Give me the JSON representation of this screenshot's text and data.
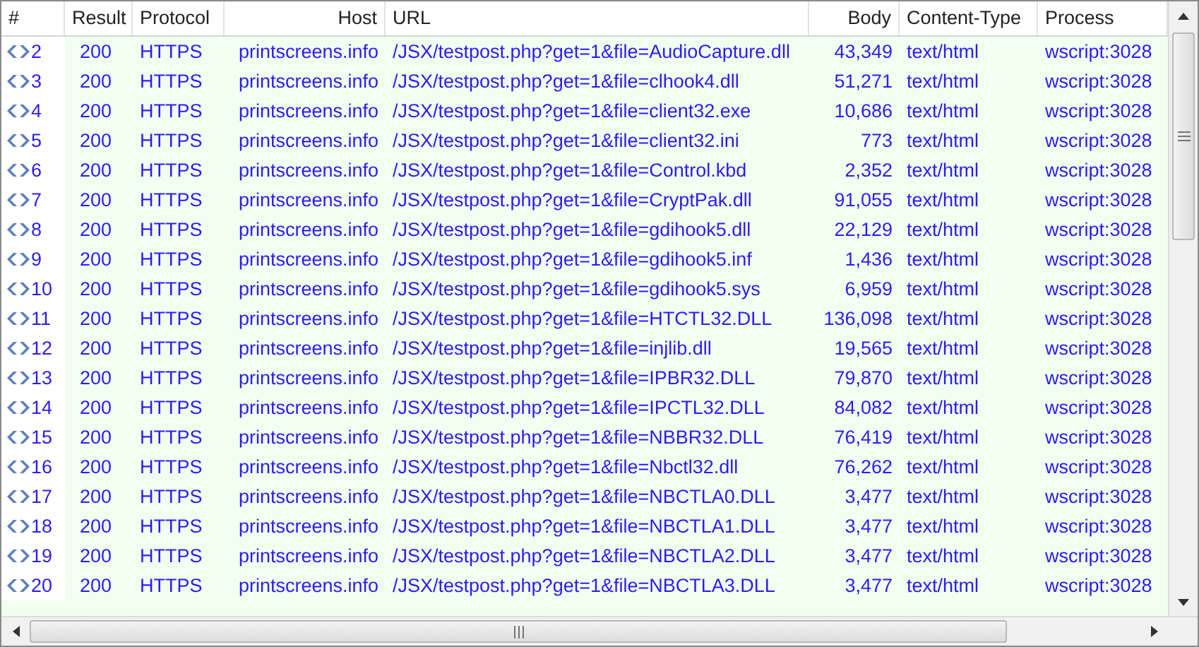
{
  "columns": [
    {
      "label": "#"
    },
    {
      "label": "Result"
    },
    {
      "label": "Protocol"
    },
    {
      "label": "Host"
    },
    {
      "label": "URL"
    },
    {
      "label": "Body"
    },
    {
      "label": "Content-Type"
    },
    {
      "label": "Process"
    }
  ],
  "rows": [
    {
      "id": "2",
      "result": "200",
      "protocol": "HTTPS",
      "host": "printscreens.info",
      "url": "/JSX/testpost.php?get=1&file=AudioCapture.dll",
      "body": "43,349",
      "type": "text/html",
      "process": "wscript:3028"
    },
    {
      "id": "3",
      "result": "200",
      "protocol": "HTTPS",
      "host": "printscreens.info",
      "url": "/JSX/testpost.php?get=1&file=clhook4.dll",
      "body": "51,271",
      "type": "text/html",
      "process": "wscript:3028"
    },
    {
      "id": "4",
      "result": "200",
      "protocol": "HTTPS",
      "host": "printscreens.info",
      "url": "/JSX/testpost.php?get=1&file=client32.exe",
      "body": "10,686",
      "type": "text/html",
      "process": "wscript:3028"
    },
    {
      "id": "5",
      "result": "200",
      "protocol": "HTTPS",
      "host": "printscreens.info",
      "url": "/JSX/testpost.php?get=1&file=client32.ini",
      "body": "773",
      "type": "text/html",
      "process": "wscript:3028"
    },
    {
      "id": "6",
      "result": "200",
      "protocol": "HTTPS",
      "host": "printscreens.info",
      "url": "/JSX/testpost.php?get=1&file=Control.kbd",
      "body": "2,352",
      "type": "text/html",
      "process": "wscript:3028"
    },
    {
      "id": "7",
      "result": "200",
      "protocol": "HTTPS",
      "host": "printscreens.info",
      "url": "/JSX/testpost.php?get=1&file=CryptPak.dll",
      "body": "91,055",
      "type": "text/html",
      "process": "wscript:3028"
    },
    {
      "id": "8",
      "result": "200",
      "protocol": "HTTPS",
      "host": "printscreens.info",
      "url": "/JSX/testpost.php?get=1&file=gdihook5.dll",
      "body": "22,129",
      "type": "text/html",
      "process": "wscript:3028"
    },
    {
      "id": "9",
      "result": "200",
      "protocol": "HTTPS",
      "host": "printscreens.info",
      "url": "/JSX/testpost.php?get=1&file=gdihook5.inf",
      "body": "1,436",
      "type": "text/html",
      "process": "wscript:3028"
    },
    {
      "id": "10",
      "result": "200",
      "protocol": "HTTPS",
      "host": "printscreens.info",
      "url": "/JSX/testpost.php?get=1&file=gdihook5.sys",
      "body": "6,959",
      "type": "text/html",
      "process": "wscript:3028"
    },
    {
      "id": "11",
      "result": "200",
      "protocol": "HTTPS",
      "host": "printscreens.info",
      "url": "/JSX/testpost.php?get=1&file=HTCTL32.DLL",
      "body": "136,098",
      "type": "text/html",
      "process": "wscript:3028"
    },
    {
      "id": "12",
      "result": "200",
      "protocol": "HTTPS",
      "host": "printscreens.info",
      "url": "/JSX/testpost.php?get=1&file=injlib.dll",
      "body": "19,565",
      "type": "text/html",
      "process": "wscript:3028"
    },
    {
      "id": "13",
      "result": "200",
      "protocol": "HTTPS",
      "host": "printscreens.info",
      "url": "/JSX/testpost.php?get=1&file=IPBR32.DLL",
      "body": "79,870",
      "type": "text/html",
      "process": "wscript:3028"
    },
    {
      "id": "14",
      "result": "200",
      "protocol": "HTTPS",
      "host": "printscreens.info",
      "url": "/JSX/testpost.php?get=1&file=IPCTL32.DLL",
      "body": "84,082",
      "type": "text/html",
      "process": "wscript:3028"
    },
    {
      "id": "15",
      "result": "200",
      "protocol": "HTTPS",
      "host": "printscreens.info",
      "url": "/JSX/testpost.php?get=1&file=NBBR32.DLL",
      "body": "76,419",
      "type": "text/html",
      "process": "wscript:3028"
    },
    {
      "id": "16",
      "result": "200",
      "protocol": "HTTPS",
      "host": "printscreens.info",
      "url": "/JSX/testpost.php?get=1&file=Nbctl32.dll",
      "body": "76,262",
      "type": "text/html",
      "process": "wscript:3028"
    },
    {
      "id": "17",
      "result": "200",
      "protocol": "HTTPS",
      "host": "printscreens.info",
      "url": "/JSX/testpost.php?get=1&file=NBCTLA0.DLL",
      "body": "3,477",
      "type": "text/html",
      "process": "wscript:3028"
    },
    {
      "id": "18",
      "result": "200",
      "protocol": "HTTPS",
      "host": "printscreens.info",
      "url": "/JSX/testpost.php?get=1&file=NBCTLA1.DLL",
      "body": "3,477",
      "type": "text/html",
      "process": "wscript:3028"
    },
    {
      "id": "19",
      "result": "200",
      "protocol": "HTTPS",
      "host": "printscreens.info",
      "url": "/JSX/testpost.php?get=1&file=NBCTLA2.DLL",
      "body": "3,477",
      "type": "text/html",
      "process": "wscript:3028"
    },
    {
      "id": "20",
      "result": "200",
      "protocol": "HTTPS",
      "host": "printscreens.info",
      "url": "/JSX/testpost.php?get=1&file=NBCTLA3.DLL",
      "body": "3,477",
      "type": "text/html",
      "process": "wscript:3028"
    }
  ]
}
